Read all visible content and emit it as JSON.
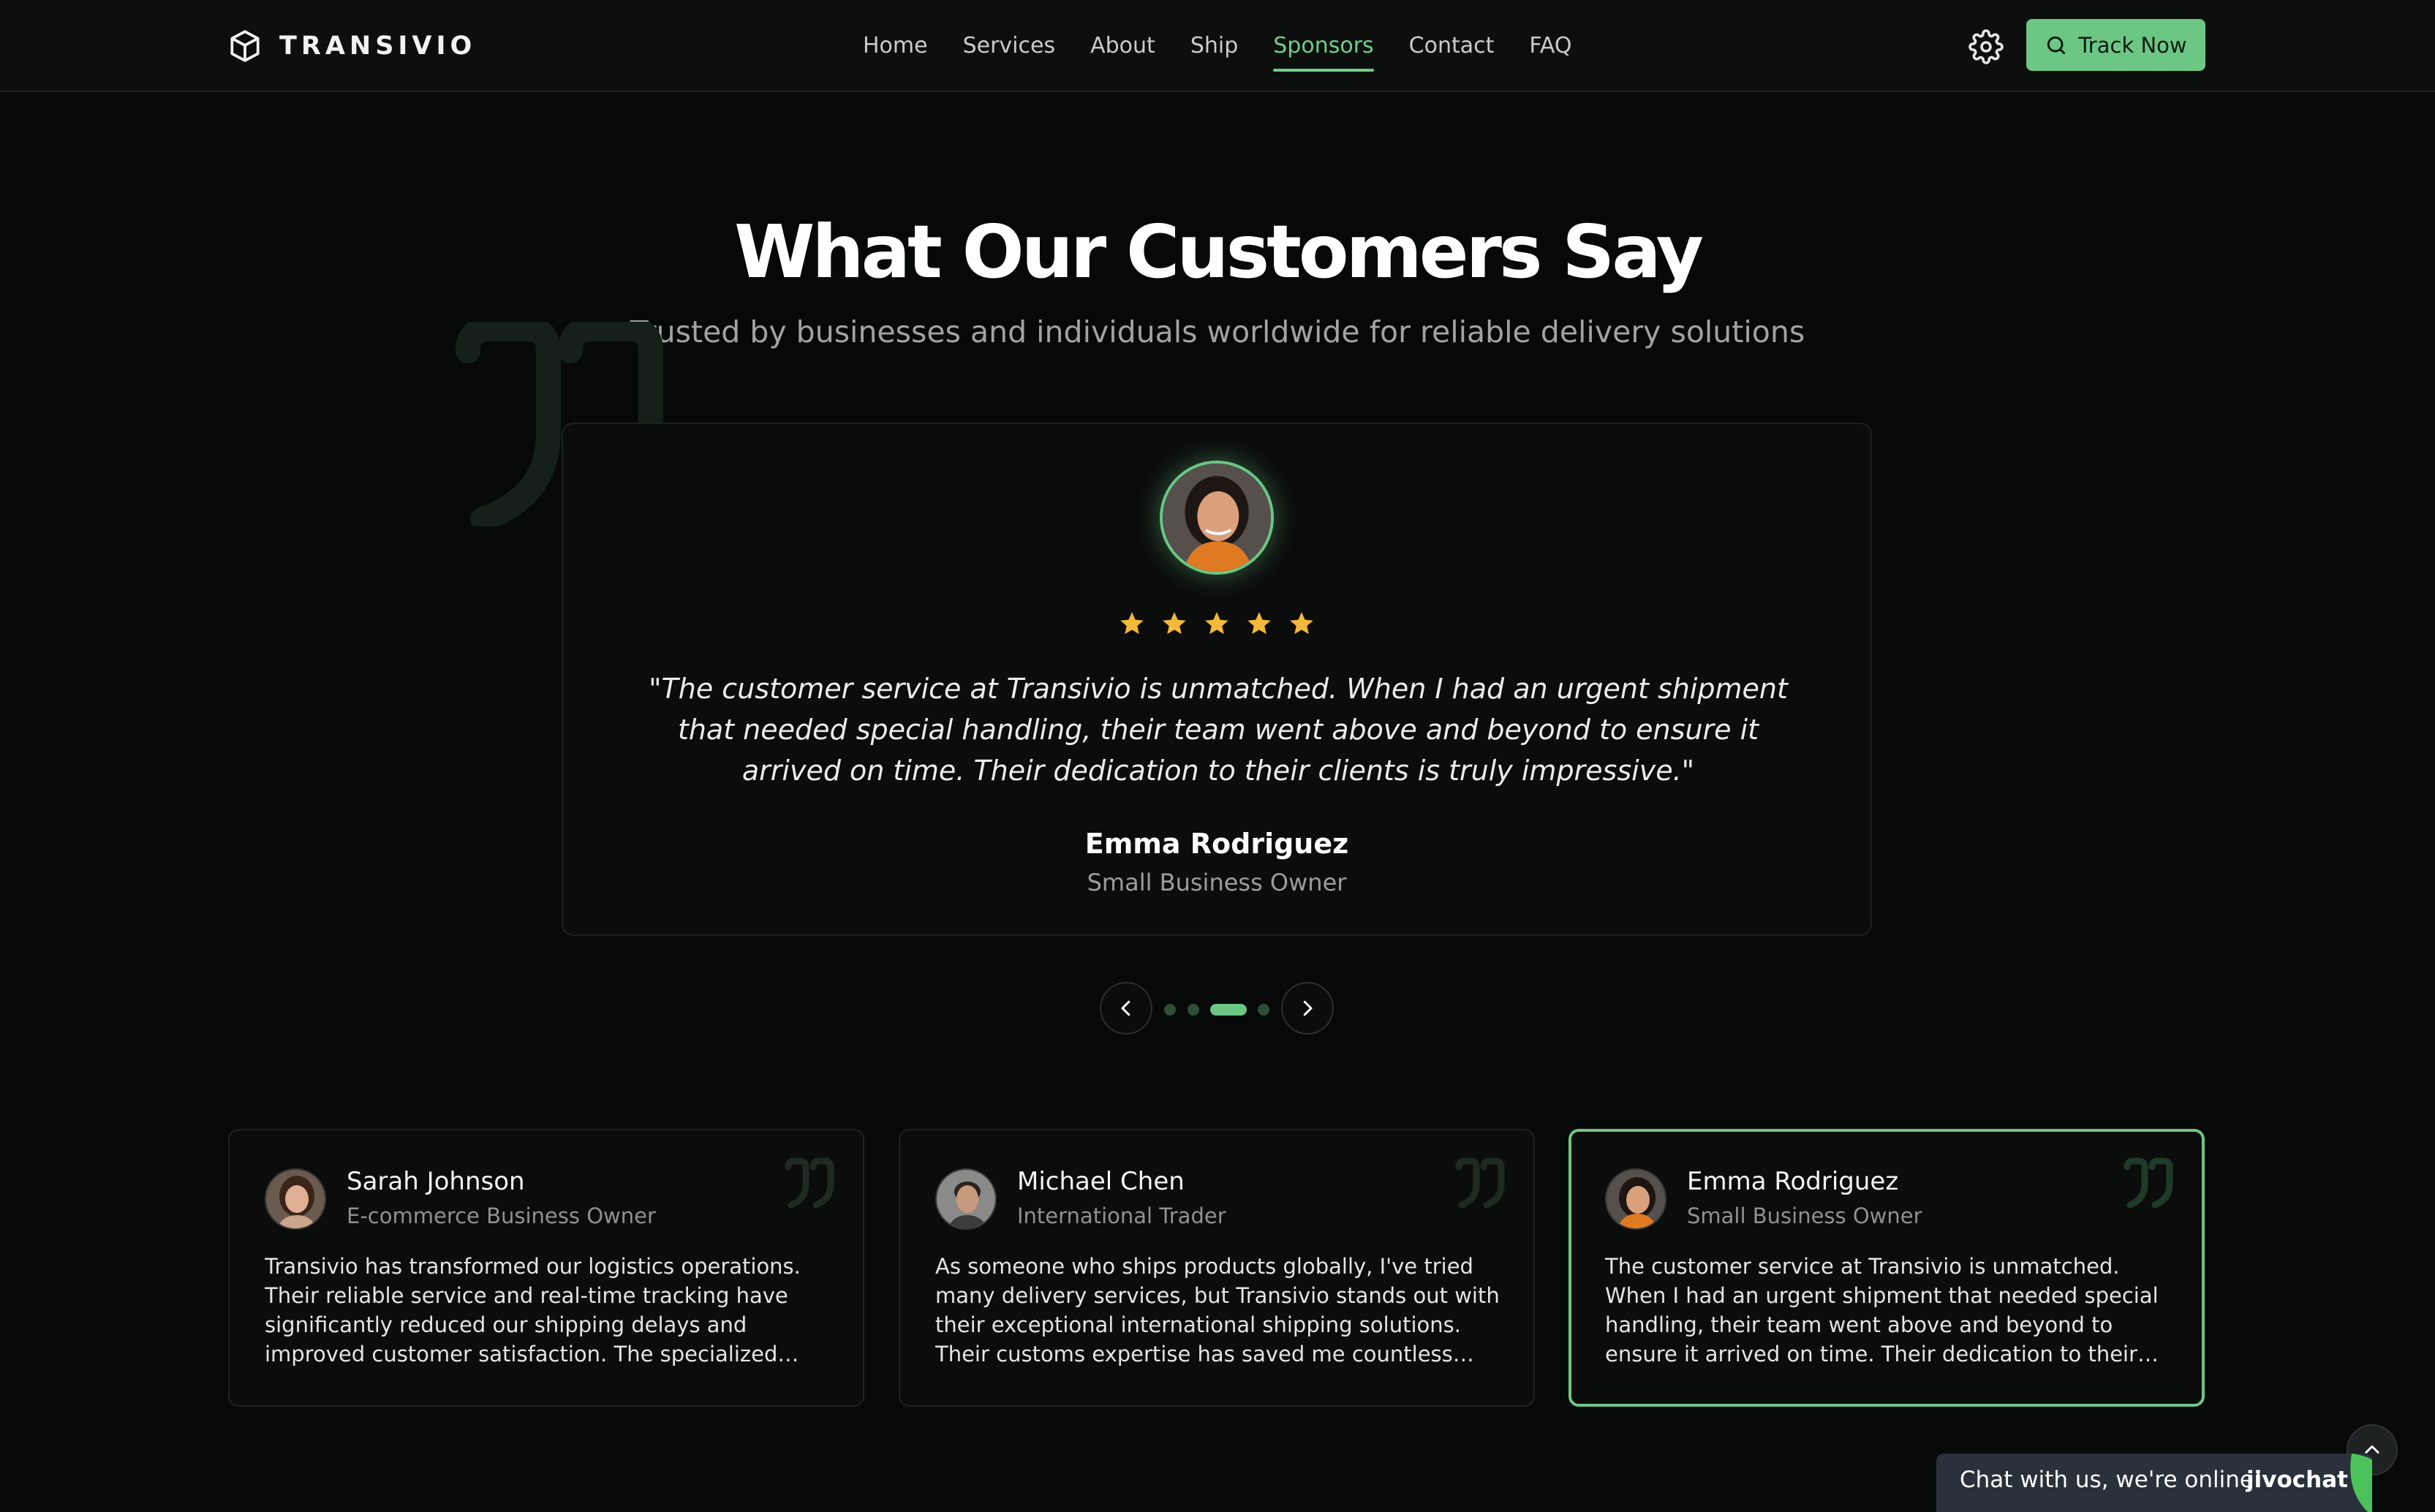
{
  "brand": {
    "name": "TRANSIVIO",
    "icon": "box-icon"
  },
  "nav": {
    "items": [
      {
        "label": "Home",
        "active": false
      },
      {
        "label": "Services",
        "active": false
      },
      {
        "label": "About",
        "active": false
      },
      {
        "label": "Ship",
        "active": false
      },
      {
        "label": "Sponsors",
        "active": true
      },
      {
        "label": "Contact",
        "active": false
      },
      {
        "label": "FAQ",
        "active": false
      }
    ]
  },
  "header_actions": {
    "settings_icon": "gear-icon",
    "track_label": "Track Now",
    "track_icon": "search-icon"
  },
  "section": {
    "title": "What Our Customers Say",
    "subtitle": "Trusted by businesses and individuals worldwide for reliable delivery solutions"
  },
  "featured": {
    "rating": 5,
    "quote": "\"The customer service at Transivio is unmatched. When I had an urgent shipment that needed special handling, their team went above and beyond to ensure it arrived on time. Their dedication to their clients is truly impressive.\"",
    "name": "Emma Rodriguez",
    "role": "Small Business Owner"
  },
  "carousel": {
    "slide_count": 4,
    "active_index": 2
  },
  "testimonials": [
    {
      "name": "Sarah Johnson",
      "role": "E-commerce Business Owner",
      "text": "Transivio has transformed our logistics operations. Their reliable service and real-time tracking have significantly reduced our shipping delays and improved customer satisfaction. The specialized handling for fragile items has made a huge difference for our business.",
      "active": false
    },
    {
      "name": "Michael Chen",
      "role": "International Trader",
      "text": "As someone who ships products globally, I've tried many delivery services, but Transivio stands out with their exceptional international shipping solutions. Their customs expertise has saved me countless hours and prevented costly delays.",
      "active": false
    },
    {
      "name": "Emma Rodriguez",
      "role": "Small Business Owner",
      "text": "The customer service at Transivio is unmatched. When I had an urgent shipment that needed special handling, their team went above and beyond to ensure it arrived on time. Their dedication to their clients is truly impressive.",
      "active": true
    }
  ],
  "chat": {
    "label": "Chat with us, we're online!",
    "brand": "jivochat"
  },
  "colors": {
    "accent": "#6cc785",
    "star": "#f4b83a",
    "background": "#070808"
  }
}
